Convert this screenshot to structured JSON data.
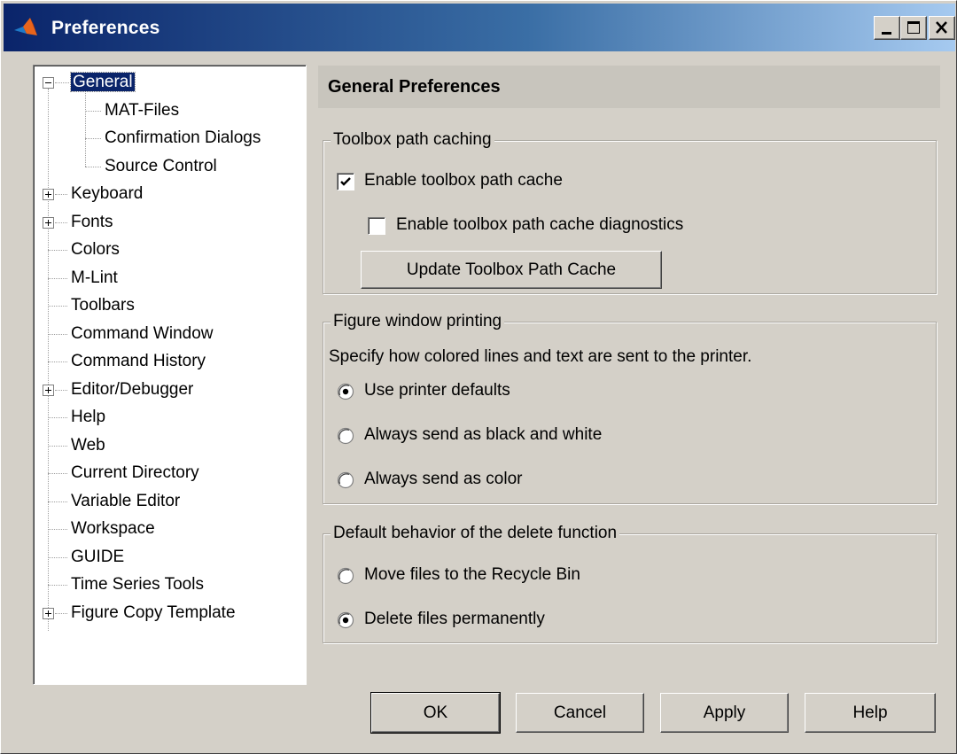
{
  "window": {
    "title": "Preferences"
  },
  "tree": {
    "items": [
      {
        "label": "General",
        "expander": "minus",
        "selected": true
      },
      {
        "label": "MAT-Files"
      },
      {
        "label": "Confirmation Dialogs"
      },
      {
        "label": "Source Control"
      },
      {
        "label": "Keyboard",
        "expander": "plus"
      },
      {
        "label": "Fonts",
        "expander": "plus"
      },
      {
        "label": "Colors"
      },
      {
        "label": "M-Lint"
      },
      {
        "label": "Toolbars"
      },
      {
        "label": "Command Window"
      },
      {
        "label": "Command History"
      },
      {
        "label": "Editor/Debugger",
        "expander": "plus"
      },
      {
        "label": "Help"
      },
      {
        "label": "Web"
      },
      {
        "label": "Current Directory"
      },
      {
        "label": "Variable Editor"
      },
      {
        "label": "Workspace"
      },
      {
        "label": "GUIDE"
      },
      {
        "label": "Time Series Tools"
      },
      {
        "label": "Figure Copy Template",
        "expander": "plus"
      }
    ]
  },
  "panel": {
    "title": "General Preferences"
  },
  "toolbox": {
    "legend": "Toolbox path caching",
    "enable_cache": {
      "label": "Enable toolbox path cache",
      "checked": true
    },
    "enable_diagnostics": {
      "label": "Enable toolbox path cache diagnostics",
      "checked": false
    },
    "update_button": "Update Toolbox Path Cache"
  },
  "printing": {
    "legend": "Figure window printing",
    "description": "Specify how colored lines and text are sent to the printer.",
    "options": [
      {
        "label": "Use printer defaults",
        "selected": true
      },
      {
        "label": "Always send as black and white",
        "selected": false
      },
      {
        "label": "Always send as color",
        "selected": false
      }
    ]
  },
  "delete": {
    "legend": "Default behavior of the delete function",
    "options": [
      {
        "label": "Move files to the Recycle Bin",
        "selected": false
      },
      {
        "label": "Delete files permanently",
        "selected": true
      }
    ]
  },
  "buttons": {
    "ok": "OK",
    "cancel": "Cancel",
    "apply": "Apply",
    "help": "Help"
  }
}
